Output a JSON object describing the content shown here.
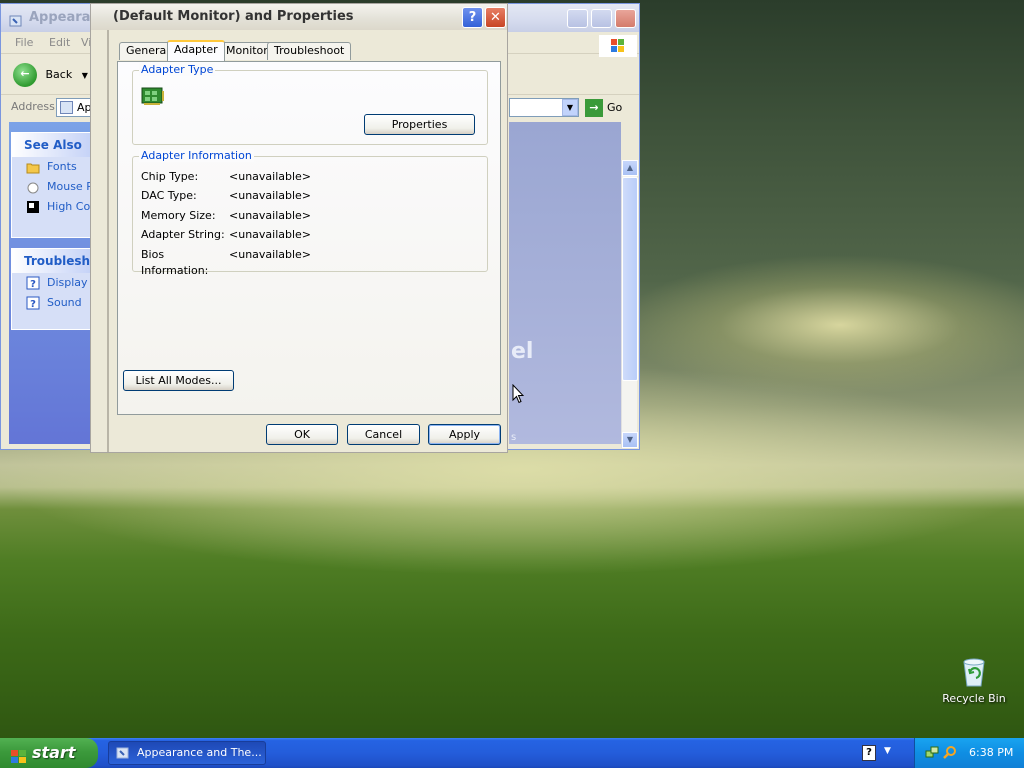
{
  "desktop": {
    "recycle_bin_label": "Recycle Bin"
  },
  "taskbar": {
    "start_label": "start",
    "task_button_label": "Appearance and The...",
    "clock": "6:38 PM",
    "lang_label": "?"
  },
  "explorer": {
    "title": "Appearance and D",
    "menu": [
      "File",
      "Edit",
      "Vi"
    ],
    "back_label": "Back",
    "address_label": "Address",
    "address_value": "Ap",
    "go_label": "Go",
    "see_also": {
      "header": "See Also",
      "items": [
        "Fonts",
        "Mouse P",
        "High Co"
      ]
    },
    "troubleshooters": {
      "header": "Troublesho",
      "items": [
        "Display",
        "Sound"
      ]
    },
    "content_text": "el",
    "content_small": "s"
  },
  "dialog": {
    "title": "(Default Monitor) and  Properties",
    "tabs": [
      "General",
      "Adapter",
      "Monitor",
      "Troubleshoot"
    ],
    "active_tab": "Adapter",
    "adapter_type": {
      "legend": "Adapter Type",
      "properties_label": "Properties"
    },
    "adapter_info": {
      "legend": "Adapter Information",
      "rows": [
        {
          "key": "Chip Type:",
          "value": "<unavailable>"
        },
        {
          "key": "DAC Type:",
          "value": "<unavailable>"
        },
        {
          "key": "Memory Size:",
          "value": "<unavailable>"
        },
        {
          "key": "Adapter String:",
          "value": "<unavailable>"
        },
        {
          "key": "Bios Information:",
          "value": "<unavailable>"
        }
      ]
    },
    "list_all_modes_label": "List All Modes...",
    "ok_label": "OK",
    "cancel_label": "Cancel",
    "apply_label": "Apply"
  },
  "colors": {
    "xp_blue": "#245ddb",
    "start_green": "#3c9a3c",
    "groupbox_legend": "#0046d5",
    "dialog_face": "#ece9d8"
  }
}
